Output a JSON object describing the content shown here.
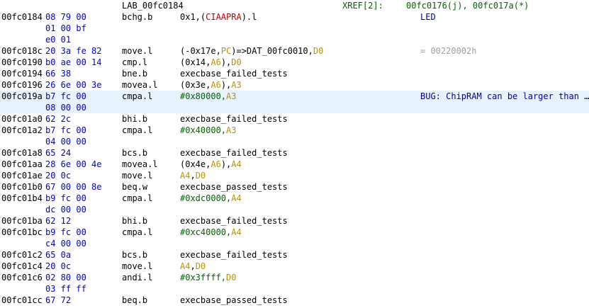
{
  "header": {
    "label": "LAB_00fc0184",
    "xref_label": "XREF[2]:",
    "xref_value": "00fc0176(j), 00fc017a(*)"
  },
  "colors": {
    "register": "#b59600",
    "symbol": "#c00000",
    "number": "#006400",
    "bytes": "#0000cc",
    "selected_row": "#e8f2fe"
  },
  "rows": [
    {
      "addr": "00fc0184",
      "bytes": "08 79 00",
      "mnem": "bchg.b",
      "ops": [
        {
          "t": "0x1,(",
          "k": "plain"
        },
        {
          "t": "CIAAPRA",
          "k": "sym"
        },
        {
          "t": ").l",
          "k": "plain"
        }
      ],
      "comment": "LED",
      "comment_style": "plate"
    },
    {
      "addr": "",
      "bytes": "01 00 bf",
      "mnem": "",
      "ops": [],
      "comment": ""
    },
    {
      "addr": "",
      "bytes": "e0 01",
      "mnem": "",
      "ops": [],
      "comment": ""
    },
    {
      "addr": "00fc018c",
      "bytes": "20 3a fe 82",
      "mnem": "move.l",
      "ops": [
        {
          "t": "(-0x17e,",
          "k": "plain"
        },
        {
          "t": "PC",
          "k": "reg"
        },
        {
          "t": ")=>DAT_00fc0010,",
          "k": "plain"
        },
        {
          "t": "D0",
          "k": "reg"
        }
      ],
      "comment": "= 00220002h",
      "comment_style": "gray"
    },
    {
      "addr": "00fc0190",
      "bytes": "b0 ae 00 14",
      "mnem": "cmp.l",
      "ops": [
        {
          "t": "(0x14,",
          "k": "plain"
        },
        {
          "t": "A6",
          "k": "reg"
        },
        {
          "t": "),",
          "k": "plain"
        },
        {
          "t": "D0",
          "k": "reg"
        }
      ],
      "comment": ""
    },
    {
      "addr": "00fc0194",
      "bytes": "66 38",
      "mnem": "bne.b",
      "ops": [
        {
          "t": "execbase_failed_tests",
          "k": "plain"
        }
      ],
      "comment": ""
    },
    {
      "addr": "00fc0196",
      "bytes": "26 6e 00 3e",
      "mnem": "movea.l",
      "ops": [
        {
          "t": "(0x3e,",
          "k": "plain"
        },
        {
          "t": "A6",
          "k": "reg"
        },
        {
          "t": "),",
          "k": "plain"
        },
        {
          "t": "A3",
          "k": "reg"
        }
      ],
      "comment": ""
    },
    {
      "addr": "00fc019a",
      "bytes": "b7 fc 00",
      "mnem": "cmpa.l",
      "ops": [
        {
          "t": "#0x80000,",
          "k": "num"
        },
        {
          "t": "A3",
          "k": "reg"
        }
      ],
      "comment": "BUG: ChipRAM can be larger than …",
      "comment_style": "plate",
      "selected": true
    },
    {
      "addr": "",
      "bytes": "08 00 00",
      "mnem": "",
      "ops": [],
      "comment": "",
      "selected": true
    },
    {
      "addr": "00fc01a0",
      "bytes": "62 2c",
      "mnem": "bhi.b",
      "ops": [
        {
          "t": "execbase_failed_tests",
          "k": "plain"
        }
      ],
      "comment": ""
    },
    {
      "addr": "00fc01a2",
      "bytes": "b7 fc 00",
      "mnem": "cmpa.l",
      "ops": [
        {
          "t": "#0x40000,",
          "k": "num"
        },
        {
          "t": "A3",
          "k": "reg"
        }
      ],
      "comment": ""
    },
    {
      "addr": "",
      "bytes": "04 00 00",
      "mnem": "",
      "ops": [],
      "comment": ""
    },
    {
      "addr": "00fc01a8",
      "bytes": "65 24",
      "mnem": "bcs.b",
      "ops": [
        {
          "t": "execbase_failed_tests",
          "k": "plain"
        }
      ],
      "comment": ""
    },
    {
      "addr": "00fc01aa",
      "bytes": "28 6e 00 4e",
      "mnem": "movea.l",
      "ops": [
        {
          "t": "(0x4e,",
          "k": "plain"
        },
        {
          "t": "A6",
          "k": "reg"
        },
        {
          "t": "),",
          "k": "plain"
        },
        {
          "t": "A4",
          "k": "reg"
        }
      ],
      "comment": ""
    },
    {
      "addr": "00fc01ae",
      "bytes": "20 0c",
      "mnem": "move.l",
      "ops": [
        {
          "t": "A4",
          "k": "reg"
        },
        {
          "t": ",",
          "k": "plain"
        },
        {
          "t": "D0",
          "k": "reg"
        }
      ],
      "comment": ""
    },
    {
      "addr": "00fc01b0",
      "bytes": "67 00 00 8e",
      "mnem": "beq.w",
      "ops": [
        {
          "t": "execbase_passed_tests",
          "k": "plain"
        }
      ],
      "comment": ""
    },
    {
      "addr": "00fc01b4",
      "bytes": "b9 fc 00",
      "mnem": "cmpa.l",
      "ops": [
        {
          "t": "#0xdc0000,",
          "k": "num"
        },
        {
          "t": "A4",
          "k": "reg"
        }
      ],
      "comment": ""
    },
    {
      "addr": "",
      "bytes": "dc 00 00",
      "mnem": "",
      "ops": [],
      "comment": ""
    },
    {
      "addr": "00fc01ba",
      "bytes": "62 12",
      "mnem": "bhi.b",
      "ops": [
        {
          "t": "execbase_failed_tests",
          "k": "plain"
        }
      ],
      "comment": ""
    },
    {
      "addr": "00fc01bc",
      "bytes": "b9 fc 00",
      "mnem": "cmpa.l",
      "ops": [
        {
          "t": "#0xc40000,",
          "k": "num"
        },
        {
          "t": "A4",
          "k": "reg"
        }
      ],
      "comment": ""
    },
    {
      "addr": "",
      "bytes": "c4 00 00",
      "mnem": "",
      "ops": [],
      "comment": ""
    },
    {
      "addr": "00fc01c2",
      "bytes": "65 0a",
      "mnem": "bcs.b",
      "ops": [
        {
          "t": "execbase_failed_tests",
          "k": "plain"
        }
      ],
      "comment": ""
    },
    {
      "addr": "00fc01c4",
      "bytes": "20 0c",
      "mnem": "move.l",
      "ops": [
        {
          "t": "A4",
          "k": "reg"
        },
        {
          "t": ",",
          "k": "plain"
        },
        {
          "t": "D0",
          "k": "reg"
        }
      ],
      "comment": ""
    },
    {
      "addr": "00fc01c6",
      "bytes": "02 80 00",
      "mnem": "andi.l",
      "ops": [
        {
          "t": "#0x3ffff,",
          "k": "num"
        },
        {
          "t": "D0",
          "k": "reg"
        }
      ],
      "comment": ""
    },
    {
      "addr": "",
      "bytes": "03 ff ff",
      "mnem": "",
      "ops": [],
      "comment": ""
    },
    {
      "addr": "00fc01cc",
      "bytes": "67 72",
      "mnem": "beq.b",
      "ops": [
        {
          "t": "execbase_passed_tests",
          "k": "plain"
        }
      ],
      "comment": ""
    }
  ]
}
